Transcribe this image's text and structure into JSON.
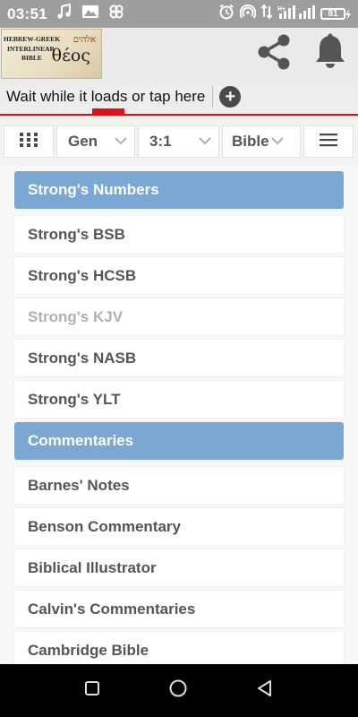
{
  "status_bar": {
    "time": "03:51",
    "battery": "81",
    "left_icons": [
      "music-icon",
      "image-icon",
      "pinwheel-icon"
    ],
    "right_icons": [
      "alarm-icon",
      "hotspot-icon",
      "data-arrows-icon",
      "signal-icon",
      "battery-icon"
    ]
  },
  "header": {
    "logo": {
      "line1": "HEBREW-GREEK",
      "line2": "INTERLINEAR",
      "line3": "BIBLE",
      "hebrew": "אלהים",
      "greek": "θέος"
    },
    "icons": [
      "share-icon",
      "bell-icon"
    ]
  },
  "load_bar": {
    "text": "Wait while it loads or tap here",
    "progress": 0.09
  },
  "toolbar": {
    "book": "Gen",
    "chapter": "3:1",
    "version": "Bible"
  },
  "sections": [
    {
      "title": "Strong's Numbers",
      "items": [
        {
          "label": "Strong's BSB",
          "dim": false
        },
        {
          "label": "Strong's HCSB",
          "dim": false
        },
        {
          "label": "Strong's KJV",
          "dim": true
        },
        {
          "label": "Strong's NASB",
          "dim": false
        },
        {
          "label": "Strong's YLT",
          "dim": false
        }
      ]
    },
    {
      "title": "Commentaries",
      "items": [
        {
          "label": "Barnes' Notes",
          "dim": false
        },
        {
          "label": "Benson Commentary",
          "dim": false
        },
        {
          "label": "Biblical Illustrator",
          "dim": false
        },
        {
          "label": "Calvin's Commentaries",
          "dim": false
        },
        {
          "label": "Cambridge Bible",
          "dim": false
        }
      ]
    }
  ],
  "colors": {
    "section_header": "#7aa8d2",
    "accent_red": "#e0101b",
    "status_bar": "#9e9e9e"
  }
}
